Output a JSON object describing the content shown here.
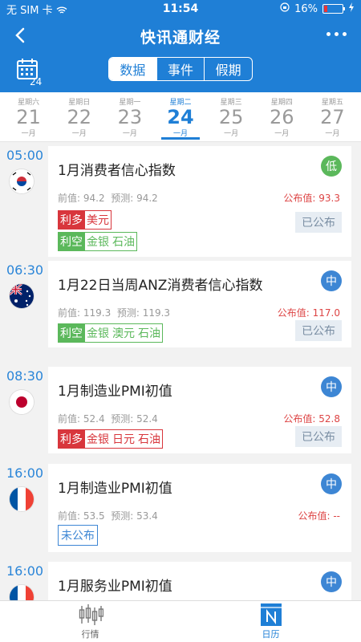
{
  "status_bar": {
    "carrier": "无 SIM 卡",
    "time": "11:54",
    "battery": "16%",
    "battery_level": 0.16
  },
  "navbar": {
    "title": "快讯通财经"
  },
  "calendar_icon": {
    "day": "24"
  },
  "segments": [
    {
      "label": "数据",
      "active": true
    },
    {
      "label": "事件",
      "active": false
    },
    {
      "label": "假期",
      "active": false
    }
  ],
  "dates": [
    {
      "weekday": "星期六",
      "day": "21",
      "month": "一月",
      "active": false
    },
    {
      "weekday": "星期日",
      "day": "22",
      "month": "一月",
      "active": false
    },
    {
      "weekday": "星期一",
      "day": "23",
      "month": "一月",
      "active": false
    },
    {
      "weekday": "星期二",
      "day": "24",
      "month": "一月",
      "active": true
    },
    {
      "weekday": "星期三",
      "day": "25",
      "month": "一月",
      "active": false
    },
    {
      "weekday": "星期四",
      "day": "26",
      "month": "一月",
      "active": false
    },
    {
      "weekday": "星期五",
      "day": "27",
      "month": "一月",
      "active": false
    }
  ],
  "events": [
    {
      "time": "05:00",
      "country": "south-korea",
      "name": "1月消费者信心指数",
      "importance": "低",
      "importance_color": "#5bb85b",
      "prev": "前值: 94.2",
      "forecast": "预测: 94.2",
      "published": "公布值: 93.3",
      "good_label": "利多",
      "good_items": [
        "美元"
      ],
      "bad_label": "利空",
      "bad_items": [
        "金银",
        "石油"
      ],
      "status": "已公布"
    },
    {
      "time": "06:30",
      "country": "australia",
      "name": "1月22日当周ANZ消费者信心指数",
      "importance": "中",
      "importance_color": "#3d86d4",
      "prev": "前值: 119.3",
      "forecast": "预测: 119.3",
      "published": "公布值: 117.0",
      "bad_label": "利空",
      "bad_items": [
        "金银",
        "澳元",
        "石油"
      ],
      "status": "已公布"
    },
    {
      "time": "08:30",
      "country": "japan",
      "name": "1月制造业PMI初值",
      "importance": "中",
      "importance_color": "#3d86d4",
      "prev": "前值: 52.4",
      "forecast": "预测: 52.4",
      "published": "公布值: 52.8",
      "good_label": "利多",
      "good_items": [
        "金银",
        "日元",
        "石油"
      ],
      "status": "已公布"
    },
    {
      "time": "16:00",
      "country": "france",
      "name": "1月制造业PMI初值",
      "importance": "中",
      "importance_color": "#3d86d4",
      "prev": "前值: 53.5",
      "forecast": "预测: 53.4",
      "published": "公布值: --",
      "unpublished": "未公布"
    },
    {
      "time": "16:00",
      "country": "france",
      "name": "1月服务业PMI初值",
      "importance": "中",
      "importance_color": "#3d86d4"
    }
  ],
  "tabbar": [
    {
      "label": "行情",
      "icon": "candlestick-icon",
      "active": false
    },
    {
      "label": "日历",
      "icon": "calendar-n-icon",
      "active": true
    }
  ]
}
